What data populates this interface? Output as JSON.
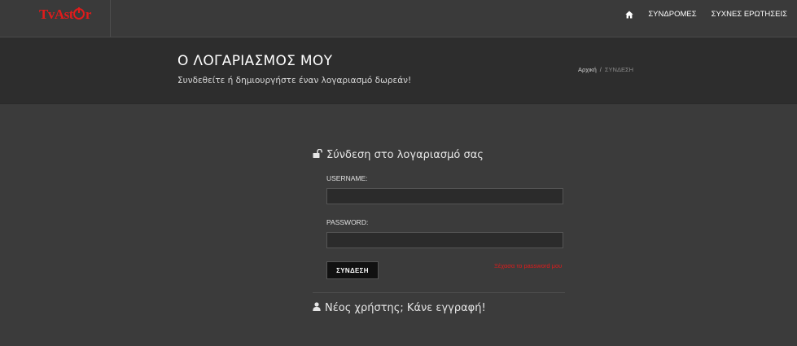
{
  "header": {
    "logo": {
      "part1": "TvAst",
      "part2": "r"
    },
    "nav": {
      "home_icon": "home-icon",
      "items": [
        {
          "label": "ΣΥΝΔΡΟΜΕΣ"
        },
        {
          "label": "ΣΥΧΝΕΣ ΕΡΩΤΗΣΕΙΣ"
        }
      ]
    }
  },
  "banner": {
    "title": "Ο ΛΟΓΑΡΙΑΣΜΟΣ ΜΟΥ",
    "subtitle": "Συνδεθείτε ή δημιουργήστε έναν λογαριασμό δωρεάν!",
    "breadcrumb": {
      "home": "Αρχική",
      "separator": "/",
      "current": "ΣΥΝΔΕΣΗ"
    }
  },
  "login": {
    "heading": "Σύνδεση στο λογαριασμό σας",
    "heading_icon": "unlock-icon",
    "username_label": "USERNAME:",
    "username_value": "",
    "password_label": "PASSWORD:",
    "password_value": "",
    "submit_label": "ΣΥΝΔΕΣΗ",
    "forgot_label": "Ξέχασα το password μου"
  },
  "register": {
    "icon": "user-icon",
    "text": "Νέος χρήστης; Κάνε εγγραφή!"
  },
  "colors": {
    "accent": "#e01b1b",
    "background": "#3b3b3b",
    "banner": "#2d2d2d",
    "input_bg": "#2b2b2b",
    "button_bg": "#111111"
  }
}
